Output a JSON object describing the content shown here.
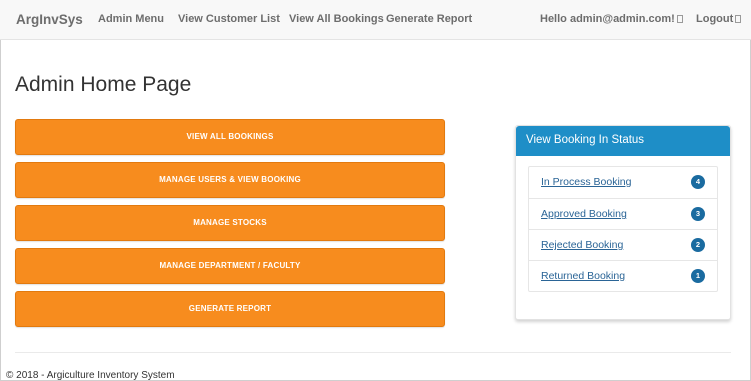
{
  "navbar": {
    "brand": "ArgInvSys",
    "links": [
      "Admin Menu",
      "View Customer List",
      "View All Bookings",
      "Generate Report"
    ],
    "hello": "Hello admin@admin.com!",
    "logout": "Logout"
  },
  "page_title": "Admin Home Page",
  "buttons": [
    "VIEW ALL BOOKINGS",
    "MANAGE USERS & VIEW BOOKING",
    "MANAGE STOCKS",
    "MANAGE DEPARTMENT / FACULTY",
    "GENERATE REPORT"
  ],
  "status_panel": {
    "title": "View Booking In Status",
    "items": [
      {
        "label": "In Process Booking",
        "count": "4"
      },
      {
        "label": "Approved Booking",
        "count": "3"
      },
      {
        "label": "Rejected Booking",
        "count": "2"
      },
      {
        "label": "Returned Booking",
        "count": "1"
      }
    ]
  },
  "footer": "© 2018 - Argiculture Inventory System",
  "colors": {
    "button": "#f78c1e",
    "panel_header": "#1e8ec7",
    "badge": "#1a6ba0",
    "link": "#2a6496"
  }
}
